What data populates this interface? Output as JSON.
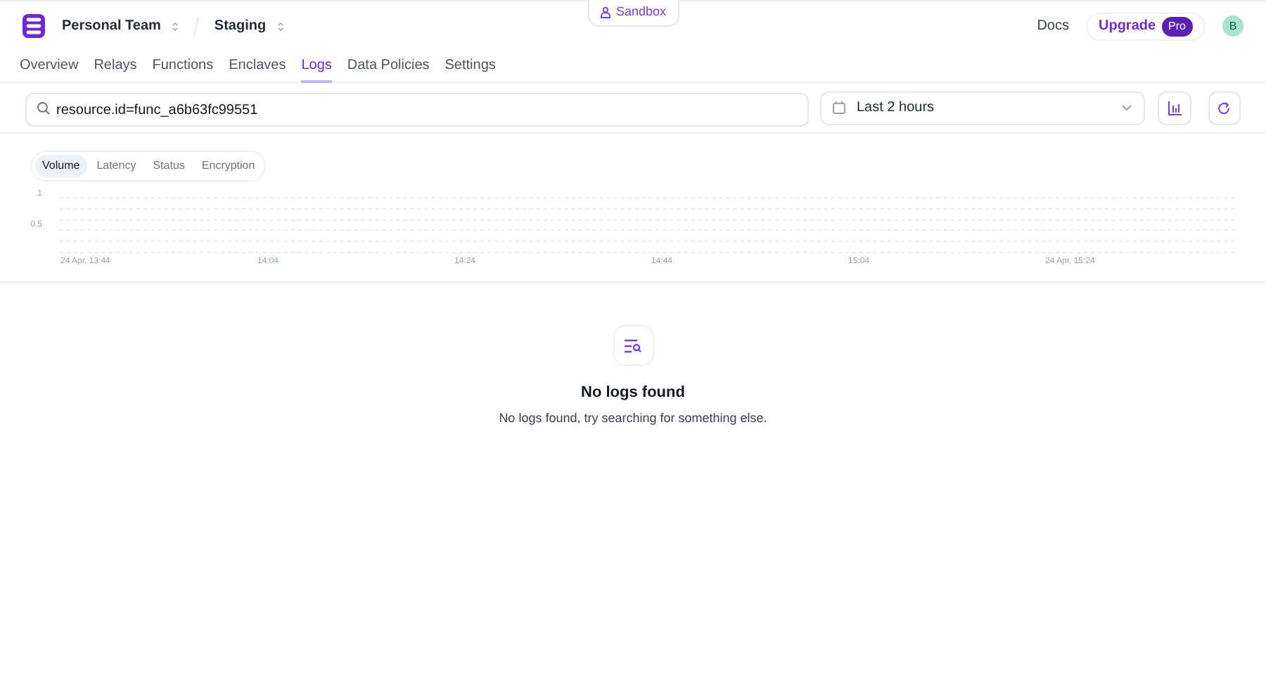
{
  "sandbox_badge": "Sandbox",
  "team_switcher": "Personal Team",
  "environment_switcher": "Staging",
  "header_links": {
    "docs": "Docs",
    "upgrade": "Upgrade",
    "plan_badge": "Pro",
    "avatar": "B"
  },
  "nav_tabs": [
    {
      "label": "Overview",
      "selected": false
    },
    {
      "label": "Relays",
      "selected": false
    },
    {
      "label": "Functions",
      "selected": false
    },
    {
      "label": "Enclaves",
      "selected": false
    },
    {
      "label": "Logs",
      "selected": true
    },
    {
      "label": "Data Policies",
      "selected": false
    },
    {
      "label": "Settings",
      "selected": false
    }
  ],
  "search": {
    "value": "resource.id=func_a6b63fc99551"
  },
  "time_range": "Last 2 hours",
  "chart_tabs": [
    {
      "label": "Volume",
      "selected": true
    },
    {
      "label": "Latency",
      "selected": false
    },
    {
      "label": "Status",
      "selected": false
    },
    {
      "label": "Encryption",
      "selected": false
    }
  ],
  "chart": {
    "y_labels": [
      "1",
      "0.5"
    ],
    "x_labels": [
      "24 Apr, 13:44",
      "14:04",
      "14:24",
      "14:44",
      "15:04",
      "24 Apr, 15:24"
    ]
  },
  "empty_state": {
    "title": "No logs found",
    "message": "No logs found, try searching for something else."
  }
}
